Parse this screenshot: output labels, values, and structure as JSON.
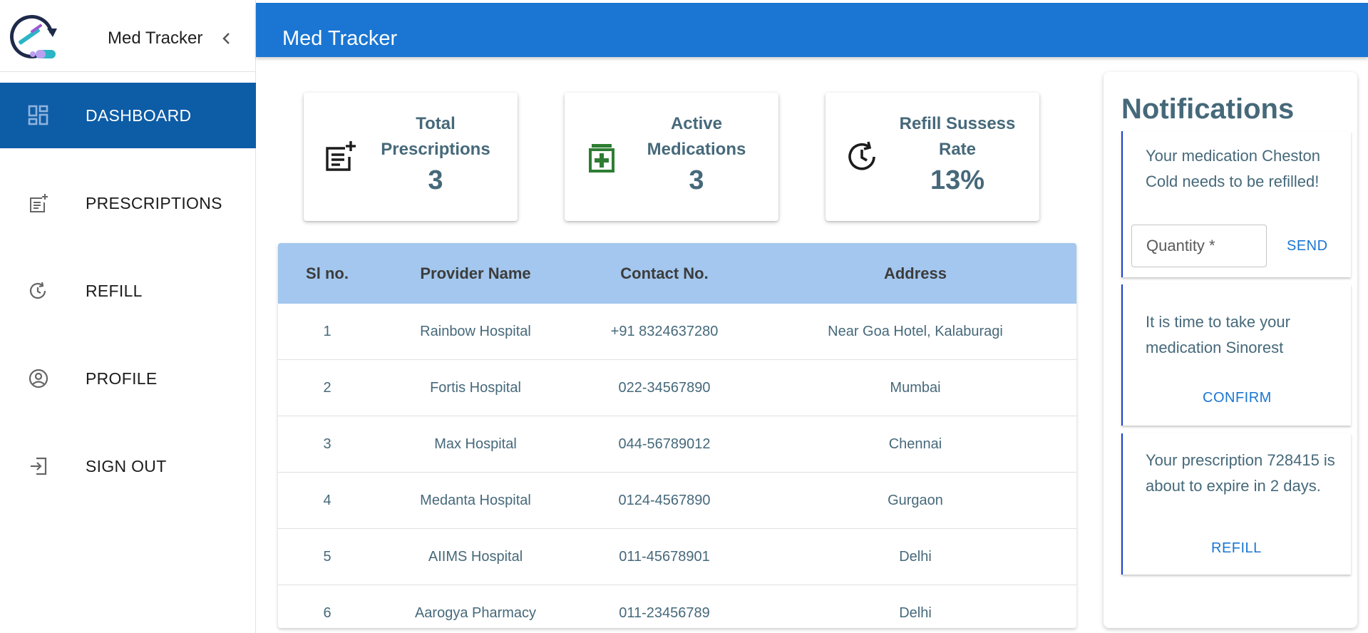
{
  "app": {
    "brand_title": "Med Tracker",
    "topbar_title": "Med Tracker"
  },
  "sidebar": {
    "items": [
      {
        "label": "DASHBOARD",
        "icon": "dashboard-icon",
        "active": true
      },
      {
        "label": "PRESCRIPTIONS",
        "icon": "prescriptions-icon",
        "active": false
      },
      {
        "label": "REFILL",
        "icon": "refill-icon",
        "active": false
      },
      {
        "label": "PROFILE",
        "icon": "profile-icon",
        "active": false
      },
      {
        "label": "SIGN OUT",
        "icon": "sign-out-icon",
        "active": false
      }
    ]
  },
  "stats": [
    {
      "title": "Total Prescriptions",
      "value": "3",
      "icon": "prescription-add-icon"
    },
    {
      "title": "Active Medications",
      "value": "3",
      "icon": "medication-icon"
    },
    {
      "title": "Refill Sussess Rate",
      "value": "13%",
      "icon": "history-clock-icon"
    }
  ],
  "table": {
    "headers": [
      "Sl no.",
      "Provider Name",
      "Contact No.",
      "Address"
    ],
    "rows": [
      [
        "1",
        "Rainbow Hospital",
        "+91 8324637280",
        "Near Goa Hotel, Kalaburagi"
      ],
      [
        "2",
        "Fortis Hospital",
        "022-34567890",
        "Mumbai"
      ],
      [
        "3",
        "Max Hospital",
        "044-56789012",
        "Chennai"
      ],
      [
        "4",
        "Medanta Hospital",
        "0124-4567890",
        "Gurgaon"
      ],
      [
        "5",
        "AIIMS Hospital",
        "011-45678901",
        "Delhi"
      ],
      [
        "6",
        "Aarogya Pharmacy",
        "011-23456789",
        "Delhi"
      ]
    ]
  },
  "notifications": {
    "title": "Notifications",
    "items": [
      {
        "text": "Your medication Cheston Cold needs to be refilled!",
        "input_placeholder": "Quantity *",
        "action": "SEND"
      },
      {
        "text": "It is time to take your medication Sinorest",
        "action": "CONFIRM"
      },
      {
        "text": "Your prescription 728415 is about to expire in 2 days.",
        "action": "REFILL"
      }
    ]
  },
  "colors": {
    "topbar": "#1a76d2",
    "sidebar_active": "#0d5ca6",
    "table_header": "#a3c7ee",
    "text_muted": "#46697a",
    "notif_border": "#1a3fd2",
    "medication_icon": "#2e7d32"
  }
}
